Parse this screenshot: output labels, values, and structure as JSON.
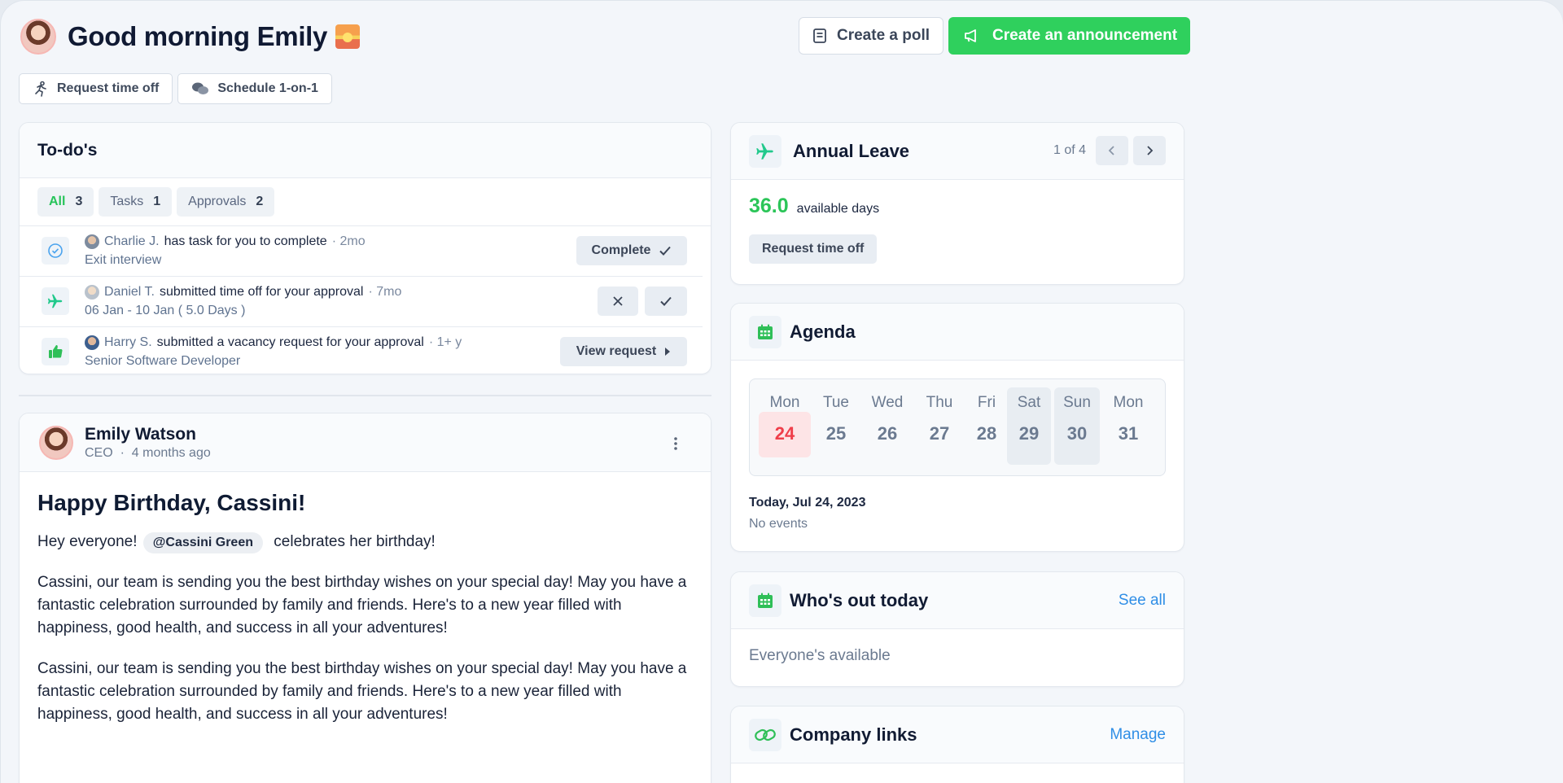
{
  "header": {
    "greeting": "Good morning Emily",
    "create_poll": "Create a poll",
    "create_announcement": "Create an announcement",
    "request_time_off": "Request time off",
    "schedule_1on1": "Schedule 1-on-1"
  },
  "todos": {
    "title": "To-do's",
    "filters": [
      {
        "label": "All",
        "count": "3"
      },
      {
        "label": "Tasks",
        "count": "1"
      },
      {
        "label": "Approvals",
        "count": "2"
      }
    ],
    "items": [
      {
        "who": "Charlie J.",
        "text": "has task for you to complete",
        "ago": "· 2mo",
        "sub": "Exit interview",
        "action": "Complete"
      },
      {
        "who": "Daniel T.",
        "text": "submitted time off for your approval",
        "ago": "· 7mo",
        "sub": "06 Jan - 10 Jan ( 5.0 Days )"
      },
      {
        "who": "Harry S.",
        "text": "submitted a vacancy request for your approval",
        "ago": "· 1+ y",
        "sub": "Senior Software Developer",
        "action": "View request"
      }
    ]
  },
  "post": {
    "author": "Emily Watson",
    "role": "CEO",
    "dot": "·",
    "time": "4 months ago",
    "title": "Happy Birthday, Cassini!",
    "p1_before": "Hey everyone!",
    "mention": "@Cassini Green",
    "p1_after": "celebrates her birthday!",
    "p2": "Cassini, our team is sending you the best birthday wishes on your special day! May you have a fantastic celebration surrounded by family and friends. Here's to a new year filled with happiness, good health, and success in all your adventures!",
    "p3": "Cassini, our team is sending you the best birthday wishes on your special day! May you have a fantastic celebration surrounded by family and friends. Here's to a new year filled with happiness, good health, and success in all your adventures!"
  },
  "leave": {
    "title": "Annual Leave",
    "pager": "1 of 4",
    "days": "36.0",
    "days_label": "available days",
    "button": "Request time off"
  },
  "agenda": {
    "title": "Agenda",
    "days": [
      {
        "name": "Mon",
        "num": "24"
      },
      {
        "name": "Tue",
        "num": "25"
      },
      {
        "name": "Wed",
        "num": "26"
      },
      {
        "name": "Thu",
        "num": "27"
      },
      {
        "name": "Fri",
        "num": "28"
      },
      {
        "name": "Sat",
        "num": "29"
      },
      {
        "name": "Sun",
        "num": "30"
      },
      {
        "name": "Mon",
        "num": "31"
      }
    ],
    "today": "Today, Jul 24, 2023",
    "none": "No events"
  },
  "out": {
    "title": "Who's out today",
    "see_all": "See all",
    "body": "Everyone's available"
  },
  "links": {
    "title": "Company links",
    "manage": "Manage"
  },
  "colors": {
    "accent_green": "#2fd05d",
    "link_blue": "#2f8ee6",
    "today_red": "#ef3e4a"
  }
}
